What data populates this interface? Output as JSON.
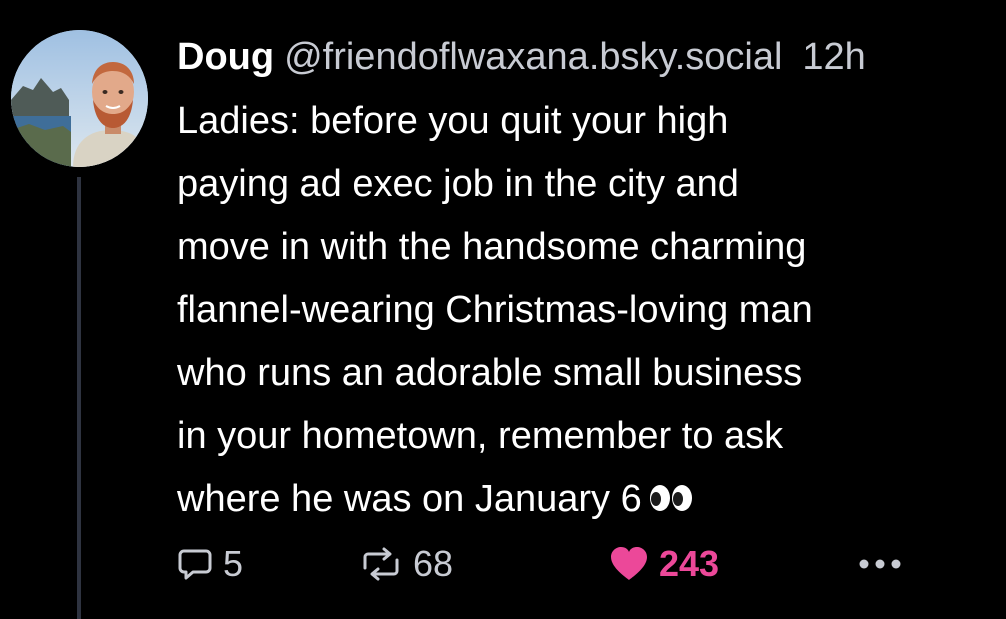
{
  "post": {
    "author": {
      "display_name": "Doug",
      "handle": "@friendoflwaxana.bsky.social",
      "avatar_icon": "profile-photo"
    },
    "timestamp": "12h",
    "text": "Ladies: before you quit your high\npaying ad exec job in the city and\nmove in with the handsome charming\nflannel-wearing Christmas-loving man\nwho runs an adorable small business\nin your hometown, remember to ask\nwhere he was on January 6",
    "emoji_icon": "eyes-icon",
    "actions": {
      "reply": {
        "icon": "reply-icon",
        "count": "5"
      },
      "repost": {
        "icon": "repost-icon",
        "count": "68"
      },
      "like": {
        "icon": "heart-icon",
        "count": "243",
        "color": "#ec4899"
      },
      "more": {
        "icon": "more-options-icon"
      }
    }
  },
  "colors": {
    "background": "#000000",
    "text": "#ffffff",
    "muted": "#c8cbd3",
    "like": "#ec4899",
    "thread_line": "#2e3340"
  }
}
